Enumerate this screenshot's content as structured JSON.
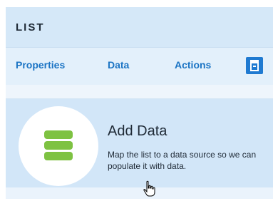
{
  "panel": {
    "title": "LIST",
    "tabs": [
      {
        "label": "Properties"
      },
      {
        "label": "Data"
      },
      {
        "label": "Actions"
      }
    ],
    "panel_button_icon": "panel-toggle-icon"
  },
  "add_data": {
    "title": "Add Data",
    "description": "Map the list to a data source so we can populate it with data.",
    "icon": "database-icon",
    "icon_color": "#7ec242"
  },
  "colors": {
    "accent": "#1b74c4",
    "header_bg": "#d5e8f8",
    "section_bg": "#d2e6f8"
  }
}
